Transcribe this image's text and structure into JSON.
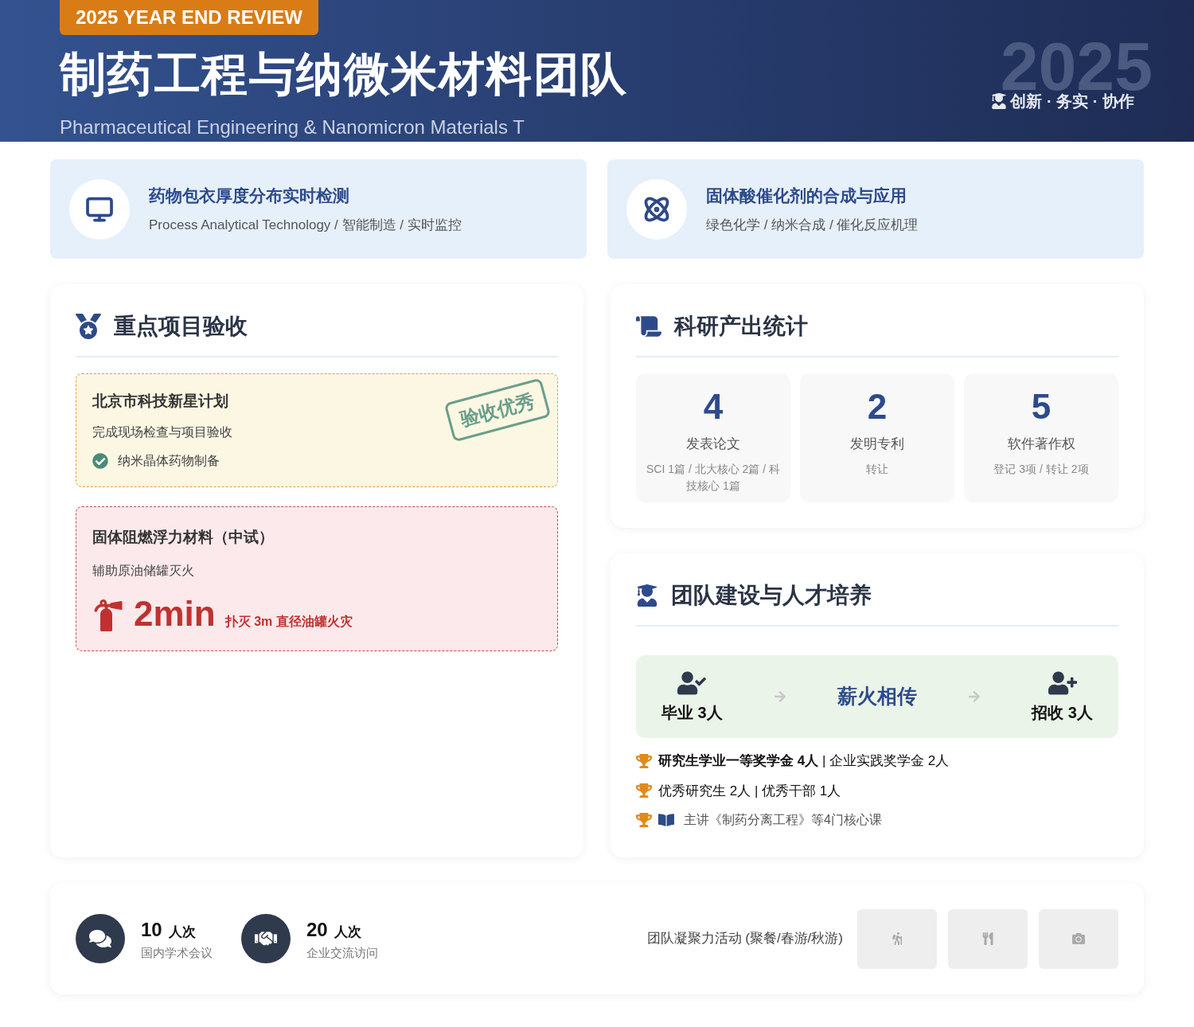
{
  "header": {
    "badge": "2025 YEAR END REVIEW",
    "title": "制药工程与纳微米材料团队",
    "subtitle": "Pharmaceutical Engineering & Nanomicron Materials T",
    "year_watermark": "2025",
    "motto": "创新 · 务实 · 协作"
  },
  "focus_cards": [
    {
      "kind": "monitor",
      "title": "药物包衣厚度分布实时检测",
      "subtitle": "Process Analytical Technology / 智能制造 / 实时监控"
    },
    {
      "kind": "atom",
      "title": "固体酸催化剂的合成与应用",
      "subtitle": "绿色化学 / 纳米合成 / 催化反应机理"
    }
  ],
  "projects": {
    "title": "重点项目验收",
    "items": [
      {
        "kind": "accepted",
        "title": "北京市科技新星计划",
        "description": "完成现场检查与项目验收",
        "stamp": "验收优秀",
        "check_item": "纳米晶体药物制备"
      },
      {
        "kind": "pilot",
        "title": "固体阻燃浮力材料（中试）",
        "description": "辅助原油储罐灭火",
        "metric_value": "2min",
        "metric_text": "扑灭 3m 直径油罐火灾"
      }
    ]
  },
  "research": {
    "title": "科研产出统计",
    "stats": [
      {
        "value": "4",
        "label": "发表论文",
        "detail": "SCI 1篇 / 北大核心 2篇 / 科技核心 1篇"
      },
      {
        "value": "2",
        "label": "发明专利",
        "detail": "转让"
      },
      {
        "value": "5",
        "label": "软件著作权",
        "detail": "登记 3项 / 转让 2项"
      }
    ]
  },
  "team": {
    "title": "团队建设与人才培养",
    "flow": {
      "left": "毕业 3人",
      "center": "薪火相传",
      "right": "招收 3人"
    },
    "honors": [
      {
        "kind": "award",
        "text": "**研究生学业一等奖学金 4人** | 企业实践奖学金 2人"
      },
      {
        "kind": "award",
        "text": "优秀研究生 2人 | 优秀干部 1人"
      },
      {
        "kind": "course",
        "text": "主讲《制药分离工程》等4门核心课"
      }
    ]
  },
  "footer": {
    "stats": [
      {
        "kind": "conference",
        "value": "10",
        "unit": "人次",
        "label": "国内学术会议"
      },
      {
        "kind": "visit",
        "value": "20",
        "unit": "人次",
        "label": "企业交流访问"
      }
    ],
    "activities_label": "团队凝聚力活动 (聚餐/春游/秋游)",
    "photos": [
      {
        "kind": "hiking"
      },
      {
        "kind": "dining"
      },
      {
        "kind": "camera"
      }
    ]
  }
}
